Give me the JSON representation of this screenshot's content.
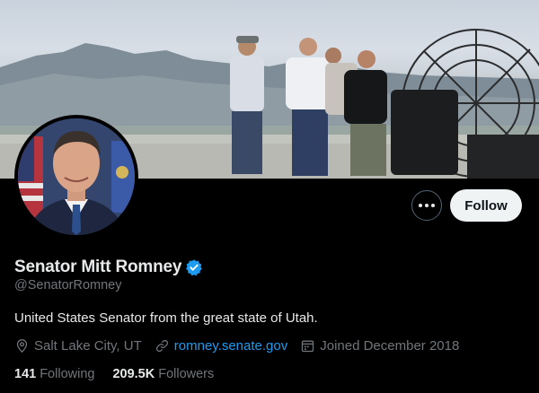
{
  "profile": {
    "display_name": "Senator Mitt Romney",
    "handle": "@SenatorRomney",
    "bio": "United States Senator from the great state of Utah.",
    "location": "Salt Lake City, UT",
    "website": "romney.senate.gov",
    "joined": "Joined December 2018",
    "following_count": "141",
    "following_label": "Following",
    "followers_count": "209.5K",
    "followers_label": "Followers"
  },
  "actions": {
    "follow_label": "Follow"
  },
  "icons": {
    "verified": "verified-badge-icon",
    "location": "location-pin-icon",
    "link": "link-icon",
    "calendar": "calendar-icon",
    "more": "more-options-icon"
  },
  "colors": {
    "background": "#000000",
    "primary_text": "#e7e9ea",
    "secondary_text": "#71767b",
    "link": "#1d9bf0",
    "verified": "#1d9bf0",
    "follow_button_bg": "#eff3f4"
  }
}
